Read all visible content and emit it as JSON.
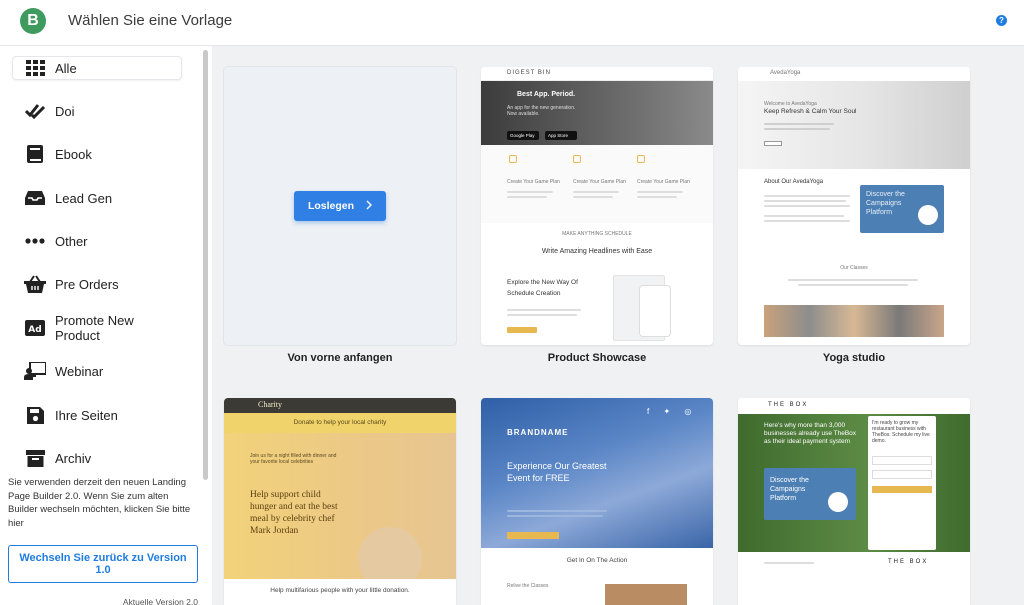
{
  "app": {
    "logo_letter": "B",
    "title": "Wählen Sie eine Vorlage",
    "help_glyph": "?"
  },
  "sidebar": {
    "items": [
      {
        "label": "Alle",
        "icon": "grid-icon"
      },
      {
        "label": "Doi",
        "icon": "double-check-icon"
      },
      {
        "label": "Ebook",
        "icon": "book-icon"
      },
      {
        "label": "Lead Gen",
        "icon": "inbox-icon"
      },
      {
        "label": "Other",
        "icon": "more-dots-icon"
      },
      {
        "label": "Pre Orders",
        "icon": "basket-icon"
      },
      {
        "label": "Promote New Product",
        "icon": "ad-icon"
      },
      {
        "label": "Webinar",
        "icon": "presenter-icon"
      },
      {
        "label": "Ihre Seiten",
        "icon": "save-icon"
      },
      {
        "label": "Archiv",
        "icon": "archive-icon"
      }
    ],
    "notice": "Sie verwenden derzeit den neuen Landing Page Builder 2.0. Wenn Sie zum alten Builder wechseln möchten, klicken Sie bitte hier",
    "switch_label": "Wechseln Sie zurück zu Version 1.0",
    "version": "Aktuelle Version 2.0"
  },
  "templates": [
    {
      "label": "Von vorne anfangen",
      "button": "Loslegen",
      "button_icon": "chevron-right-icon"
    },
    {
      "label": "Product Showcase",
      "brand": "DIGEST BIN",
      "hero_title": "Best App. Period.",
      "hero_sub": "An app for the new generation. Now available.",
      "store_a": "Google Play",
      "store_b": "App Store",
      "features": [
        "Create Your Game Plan",
        "Create Your Game Plan",
        "Create Your Game Plan"
      ],
      "kicker": "MAKE ANYTHING SCHEDULE",
      "headline": "Write Amazing Headlines with Ease",
      "explore": "Explore the New Way Of Schedule Creation"
    },
    {
      "label": "Yoga studio",
      "brand": "AvedaYoga",
      "welcome": "Welcome to AvedaYoga",
      "hero_title": "Keep Refresh & Calm Your Soul",
      "about": "About Our AvedaYoga",
      "video_title": "Discover the Campaigns Platform",
      "classes": "Our Classes"
    },
    {
      "brand": "Charity",
      "banner": "Donate to help your local charity",
      "small": "Join us for a night filled with dinner and your favorite local celebrities",
      "headline": "Help support child hunger and eat the best meal by celebrity chef Mark Jordan",
      "footer": "Help multifarious people with your little donation."
    },
    {
      "brand": "BRANDNAME",
      "headline": "Experience Our Greatest Event for FREE",
      "action": "Get In On The Action",
      "relive": "Relive the Classes"
    },
    {
      "brand": "THE BOX",
      "headline": "Here's why more than 3,000 businesses already use TheBox as their ideal payment system",
      "form_title": "I'm ready to grow my restaurant business with TheBox. Schedule my live demo.",
      "video_title": "Discover the Campaigns Platform",
      "footer_brand": "THE BOX"
    }
  ],
  "colors": {
    "accent": "#2f7fe4",
    "logo": "#3e9a5f",
    "charity_yellow": "#f3d779",
    "concert_blue": "#4b74b6",
    "box_green": "#4f7b3a"
  }
}
